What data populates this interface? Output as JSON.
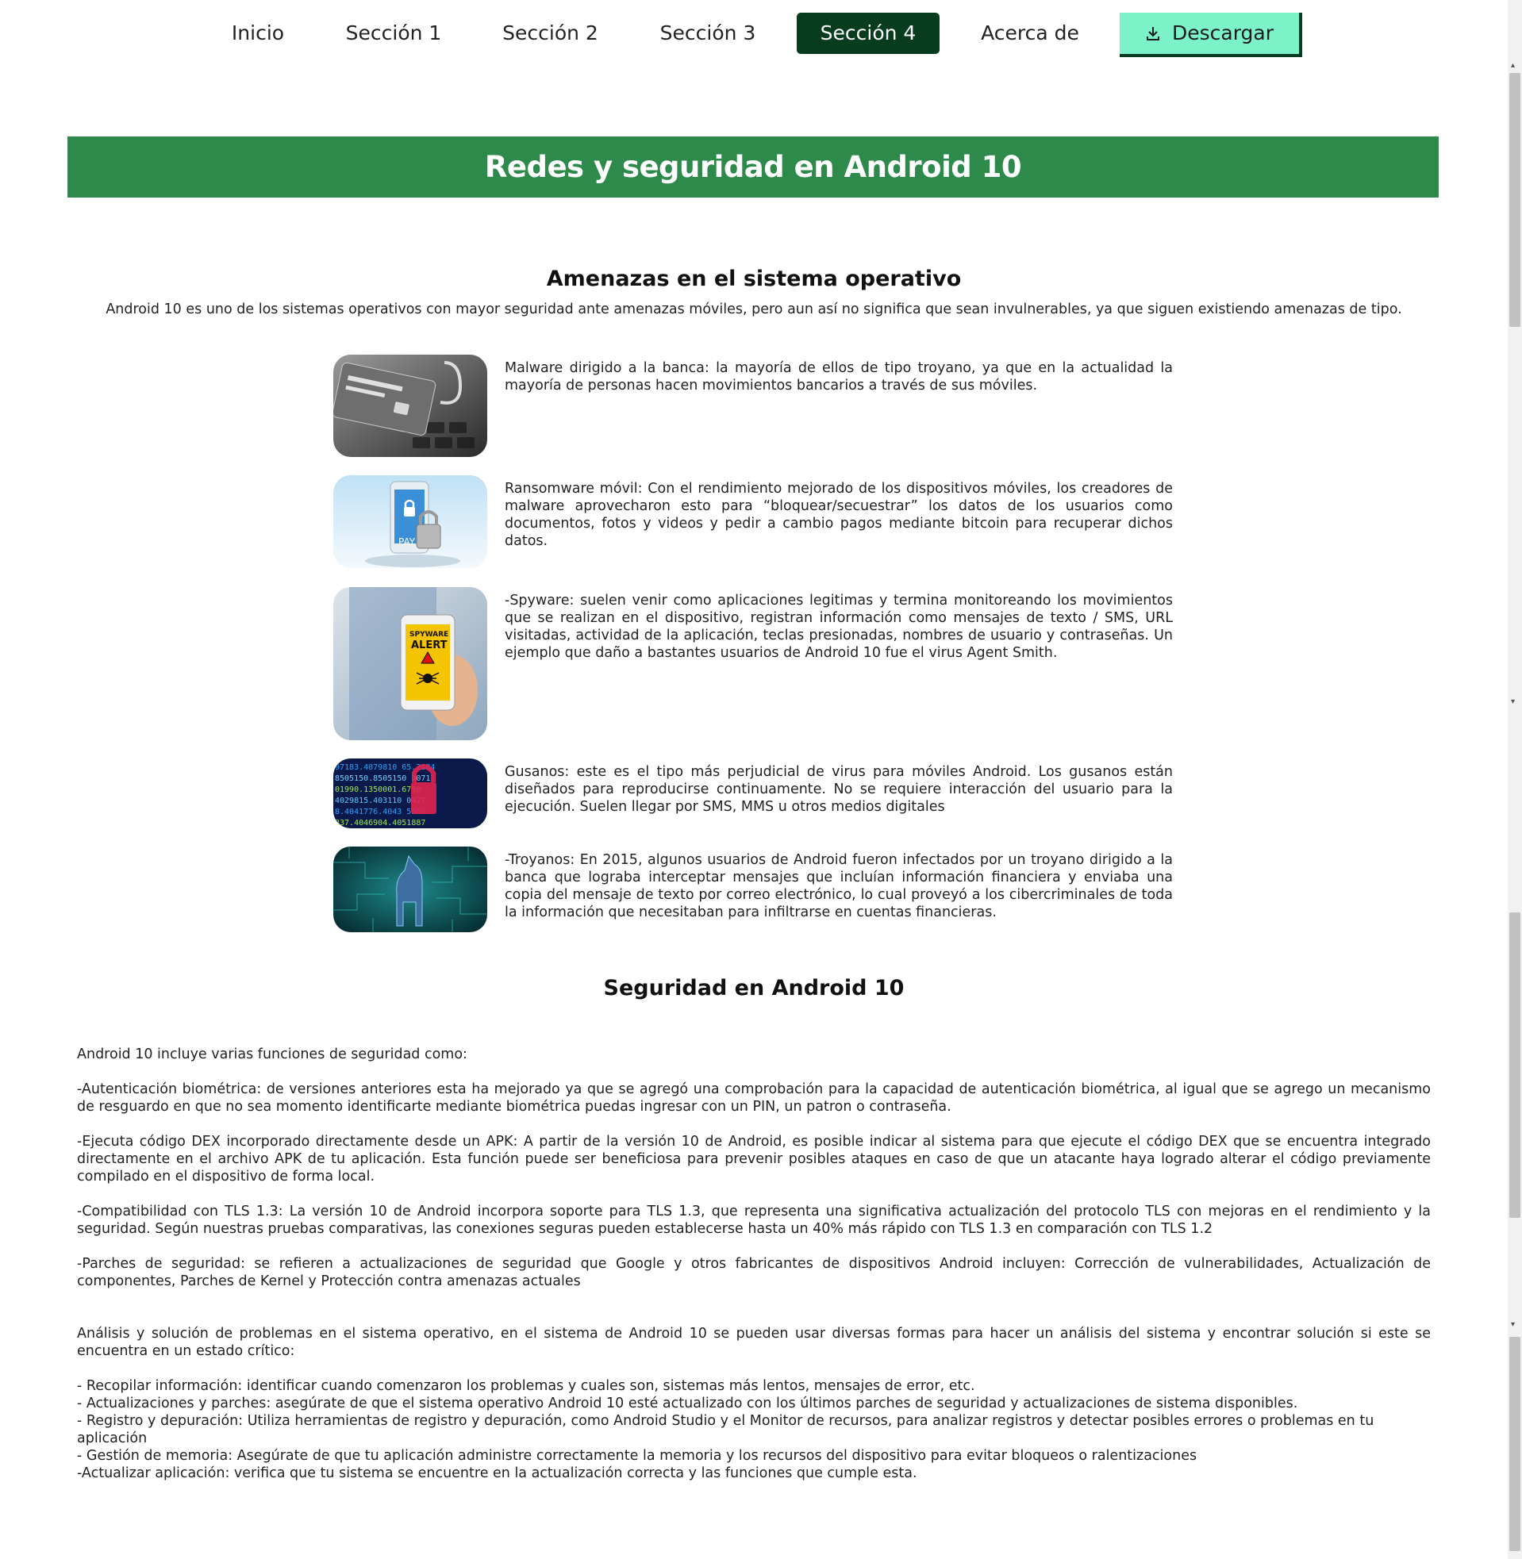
{
  "nav": {
    "items": [
      "Inicio",
      "Sección 1",
      "Sección 2",
      "Sección 3",
      "Sección 4",
      "Acerca de"
    ],
    "active_index": 4,
    "download_label": "Descargar"
  },
  "colors": {
    "nav_active_bg": "#073d1e",
    "download_bg": "#7cf2c9",
    "banner_bg": "#2d8a4a"
  },
  "banner": {
    "title": "Redes y seguridad en Android 10"
  },
  "threats_section": {
    "heading": "Amenazas en el sistema operativo",
    "intro": "Android 10 es uno de los sistemas operativos con mayor seguridad ante amenazas móviles, pero aun así no significa que sean invulnerables, ya que siguen existiendo amenazas de tipo.",
    "items": [
      {
        "image": "credit-card-hook-image",
        "text": "Malware dirigido a la banca: la mayoría de ellos de tipo troyano, ya que en la actualidad la mayoría de personas hacen movimientos bancarios a través de sus móviles."
      },
      {
        "image": "phone-padlock-image",
        "image_text": "PAY",
        "text": "Ransomware móvil: Con el rendimiento mejorado de los dispositivos móviles, los creadores de malware aprovecharon esto para “bloquear/secuestrar” los datos de los usuarios como documentos, fotos y videos y pedir a cambio pagos mediante bitcoin para recuperar dichos datos."
      },
      {
        "image": "spyware-alert-phone-image",
        "image_text_1": "SPYWARE",
        "image_text_2": "ALERT",
        "text": "-Spyware: suelen venir como aplicaciones legitimas y termina monitoreando los movimientos que se realizan en el dispositivo, registran información como mensajes de texto / SMS, URL visitadas, actividad de la aplicación, teclas presionadas, nombres de usuario y contraseñas. Un ejemplo que daño a bastantes usuarios de Android 10 fue el virus Agent Smith."
      },
      {
        "image": "binary-code-lock-image",
        "text": "Gusanos: este es el tipo más perjudicial de virus para móviles Android. Los gusanos están diseñados para reproducirse continuamente. No se requiere interacción del usuario para la ejecución. Suelen llegar por SMS, MMS u otros medios digitales"
      },
      {
        "image": "trojan-horse-circuit-image",
        "text": "-Troyanos: En 2015, algunos usuarios de Android fueron infectados por un troyano dirigido a la banca que lograba interceptar mensajes que incluían información financiera y enviaba una copia del mensaje de texto por correo electrónico, lo cual proveyó a los cibercriminales de toda la información que necesitaban para infiltrarse en cuentas financieras."
      }
    ]
  },
  "security_section": {
    "heading": "Seguridad en Android 10",
    "paragraphs": [
      "Android 10 incluye varias funciones de seguridad como:",
      "-Autenticación biométrica: de versiones anteriores esta ha mejorado ya que se agregó una comprobación para la capacidad de autenticación biométrica, al igual que se agrego un mecanismo de resguardo en que no sea momento identificarte mediante biométrica puedas ingresar con un PIN, un patron o contraseña.",
      "-Ejecuta código DEX incorporado directamente desde un APK: A partir de la versión 10 de Android, es posible indicar al sistema para que ejecute el código DEX que se encuentra integrado directamente en el archivo APK de tu aplicación. Esta función puede ser beneficiosa para prevenir posibles ataques en caso de que un atacante haya logrado alterar el código previamente compilado en el dispositivo de forma local.",
      "-Compatibilidad con TLS 1.3: La versión 10 de Android incorpora soporte para TLS 1.3, que representa una significativa actualización del protocolo TLS con mejoras en el rendimiento y la seguridad. Según nuestras pruebas comparativas, las conexiones seguras pueden establecerse hasta un 40% más rápido con TLS 1.3 en comparación con TLS 1.2",
      "-Parches de seguridad: se refieren a actualizaciones de seguridad que Google y otros fabricantes de dispositivos Android incluyen: Corrección de vulnerabilidades, Actualización de componentes, Parches de Kernel y Protección contra amenazas actuales"
    ],
    "analysis_intro": "Análisis y solución de problemas en el sistema operativo, en el sistema de Android 10 se pueden usar diversas formas para hacer un análisis del sistema y encontrar solución si este se encuentra en un estado crítico:",
    "analysis_items": [
      "- Recopilar información: identificar cuando comenzaron los problemas y cuales son, sistemas más lentos, mensajes de error, etc.",
      "- Actualizaciones y parches: asegúrate de que el sistema operativo Android 10 esté actualizado con los últimos parches de seguridad y actualizaciones de sistema disponibles.",
      "- Registro y depuración: Utiliza herramientas de registro y depuración, como Android Studio y el Monitor de recursos, para analizar registros y detectar posibles errores o problemas en tu aplicación",
      "- Gestión de memoria: Asegúrate de que tu aplicación administre correctamente la memoria y los recursos del dispositivo para evitar bloqueos o ralentizaciones",
      "-Actualizar aplicación: verifica que tu sistema se encuentre en la actualización correcta y las funciones que cumple esta."
    ]
  }
}
